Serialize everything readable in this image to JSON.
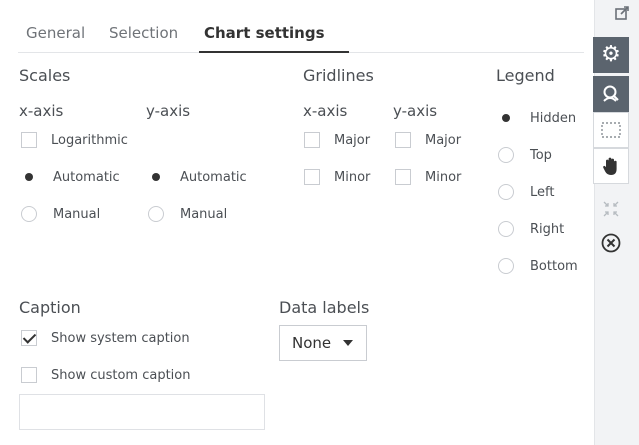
{
  "tabs": [
    {
      "label": "General"
    },
    {
      "label": "Selection"
    },
    {
      "label": "Chart settings"
    }
  ],
  "scales": {
    "title": "Scales",
    "x_axis": {
      "label": "x-axis",
      "logarithmic": {
        "label": "Logarithmic",
        "checked": false
      },
      "automatic": {
        "label": "Automatic",
        "selected": true
      },
      "manual": {
        "label": "Manual",
        "selected": false
      }
    },
    "y_axis": {
      "label": "y-axis",
      "automatic": {
        "label": "Automatic",
        "selected": true
      },
      "manual": {
        "label": "Manual",
        "selected": false
      }
    }
  },
  "gridlines": {
    "title": "Gridlines",
    "x_axis": {
      "label": "x-axis",
      "major": {
        "label": "Major",
        "checked": false
      },
      "minor": {
        "label": "Minor",
        "checked": false
      }
    },
    "y_axis": {
      "label": "y-axis",
      "major": {
        "label": "Major",
        "checked": false
      },
      "minor": {
        "label": "Minor",
        "checked": false
      }
    }
  },
  "legend": {
    "title": "Legend",
    "options": [
      {
        "label": "Hidden",
        "selected": true
      },
      {
        "label": "Top",
        "selected": false
      },
      {
        "label": "Left",
        "selected": false
      },
      {
        "label": "Right",
        "selected": false
      },
      {
        "label": "Bottom",
        "selected": false
      }
    ]
  },
  "caption": {
    "title": "Caption",
    "show_system": {
      "label": "Show system caption",
      "checked": true
    },
    "show_custom": {
      "label": "Show custom caption",
      "checked": false
    },
    "custom_text": ""
  },
  "data_labels": {
    "title": "Data labels",
    "value": "None"
  },
  "sidebar": {
    "icons": [
      "external-link-icon",
      "gear-icon",
      "lens-icon",
      "selection-marquee-icon",
      "hand-pan-icon",
      "collapse-arrows-icon",
      "close-circle-icon"
    ]
  },
  "colors": {
    "dark_button": "#5b646e",
    "text": "#4b4f54",
    "accent": "#333333"
  }
}
